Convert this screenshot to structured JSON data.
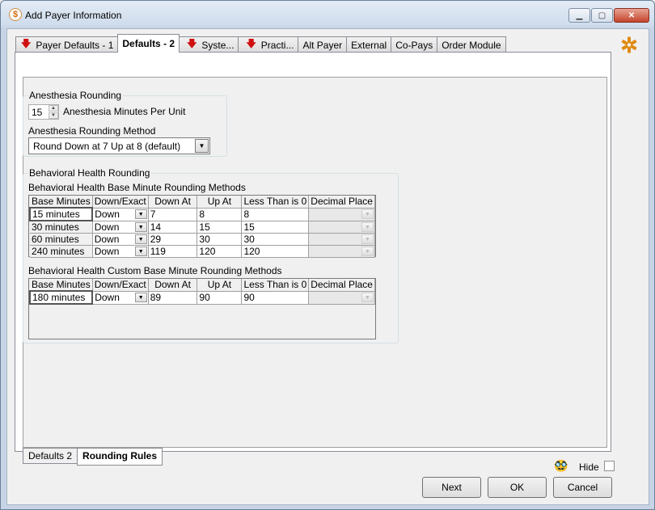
{
  "window": {
    "title": "Add Payer Information",
    "minimize": "▁",
    "maximize": "▢",
    "close": "✕"
  },
  "tabs": [
    {
      "label": "Payer Defaults - 1",
      "has_alert": true
    },
    {
      "label": "Defaults - 2",
      "active": true
    },
    {
      "label": "Syste...",
      "has_alert": true
    },
    {
      "label": "Practi...",
      "has_alert": true
    },
    {
      "label": "Alt Payer"
    },
    {
      "label": "External"
    },
    {
      "label": "Co-Pays"
    },
    {
      "label": "Order Module"
    }
  ],
  "anesthesia": {
    "group_title": "Anesthesia Rounding",
    "minutes_value": "15",
    "minutes_label": "Anesthesia Minutes Per Unit",
    "method_label": "Anesthesia Rounding Method",
    "method_value": "Round Down at 7 Up at 8 (default)"
  },
  "behavioral": {
    "group_title": "Behavioral Health Rounding",
    "base_title": "Behavioral Health Base Minute Rounding Methods",
    "custom_title": "Behavioral Health Custom Base Minute Rounding Methods",
    "columns": [
      "Base Minutes",
      "Down/Exact",
      "Down At",
      "Up At",
      "Less Than is 0",
      "Decimal Place"
    ],
    "base_rows": [
      {
        "base": "15 minutes",
        "mode": "Down",
        "down_at": "7",
        "up_at": "8",
        "less_than": "8",
        "decimal": ""
      },
      {
        "base": "30 minutes",
        "mode": "Down",
        "down_at": "14",
        "up_at": "15",
        "less_than": "15",
        "decimal": ""
      },
      {
        "base": "60 minutes",
        "mode": "Down",
        "down_at": "29",
        "up_at": "30",
        "less_than": "30",
        "decimal": ""
      },
      {
        "base": "240 minutes",
        "mode": "Down",
        "down_at": "119",
        "up_at": "120",
        "less_than": "120",
        "decimal": ""
      }
    ],
    "custom_rows": [
      {
        "base": "180 minutes",
        "mode": "Down",
        "down_at": "89",
        "up_at": "90",
        "less_than": "90",
        "decimal": ""
      }
    ]
  },
  "bottom_tabs": [
    {
      "label": "Defaults 2"
    },
    {
      "label": "Rounding Rules",
      "active": true
    }
  ],
  "footer": {
    "hide_label": "Hide",
    "hide_checked": false,
    "next": "Next",
    "ok": "OK",
    "cancel": "Cancel"
  }
}
